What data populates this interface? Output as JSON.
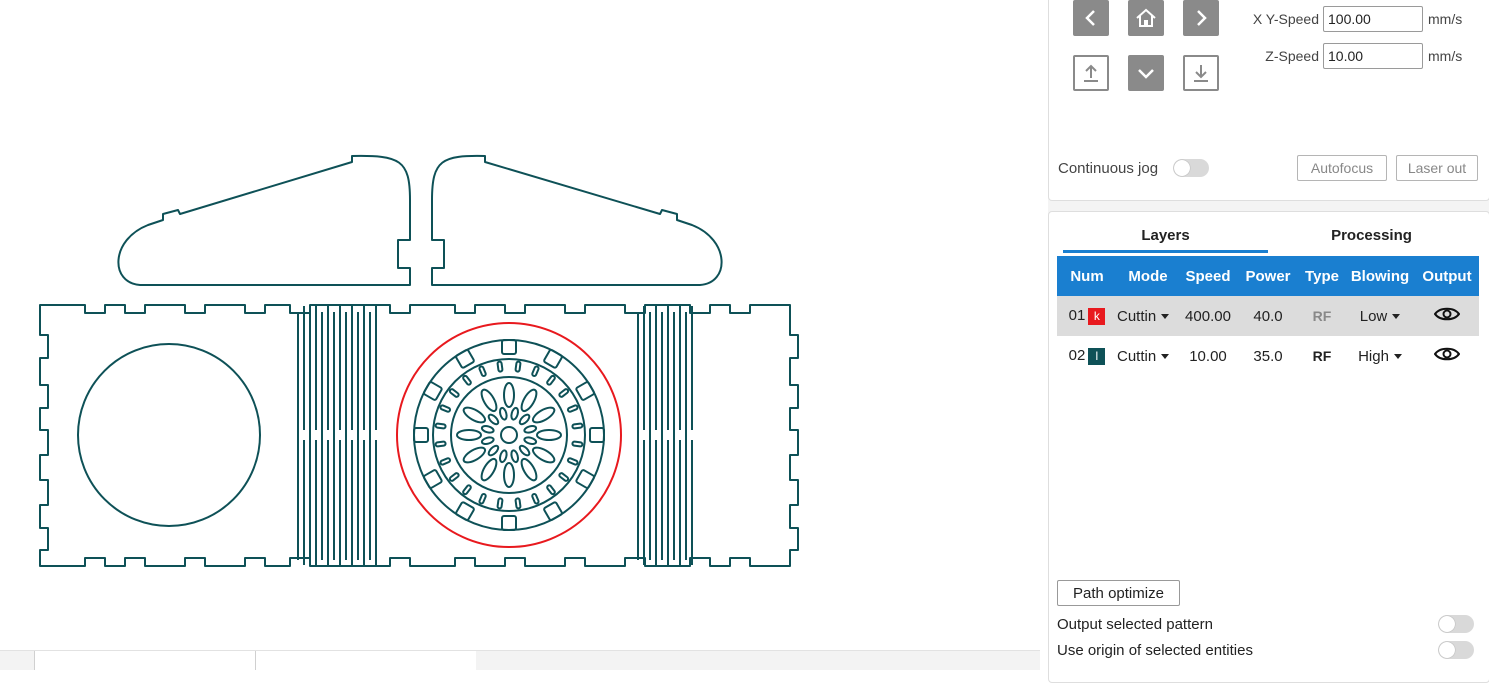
{
  "jog": {
    "xy_speed_label": "X Y-Speed",
    "xy_speed_value": "100.00",
    "z_speed_label": "Z-Speed",
    "z_speed_value": "10.00",
    "unit": "mm/s",
    "continuous_jog_label": "Continuous jog",
    "autofocus_label": "Autofocus",
    "laser_out_label": "Laser out"
  },
  "tabs": [
    {
      "label": "Layers",
      "active": true
    },
    {
      "label": "Processing",
      "active": false
    }
  ],
  "layer_table": {
    "columns": [
      "Num",
      "Mode",
      "Speed",
      "Power",
      "Type",
      "Blowing",
      "Output"
    ],
    "rows": [
      {
        "num": "01",
        "badge": "k",
        "badge_color": "#e8191e",
        "mode": "Cuttin",
        "speed": "400.00",
        "power": "40.0",
        "type": "RF",
        "blowing": "Low",
        "selected": true
      },
      {
        "num": "02",
        "badge": "l",
        "badge_color": "#0e5157",
        "mode": "Cuttin",
        "speed": "10.00",
        "power": "35.0",
        "type": "RF",
        "blowing": "High",
        "selected": false
      }
    ]
  },
  "options": {
    "path_optimize_label": "Path optimize",
    "output_selected_label": "Output selected pattern",
    "use_origin_label": "Use origin of selected entities"
  },
  "colors": {
    "accent": "#1a7fd0",
    "pattern_stroke": "#0e5157",
    "selected_outline": "#e8191e"
  },
  "icons": [
    "chevron-left-icon",
    "home-icon",
    "chevron-right-icon",
    "upload-icon",
    "chevron-down-icon",
    "download-icon",
    "eye-icon"
  ]
}
